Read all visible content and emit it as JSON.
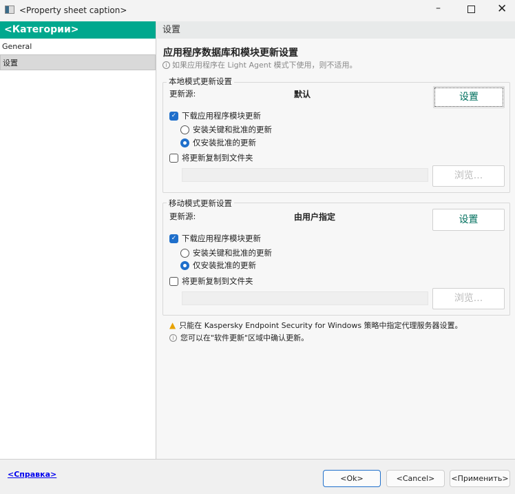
{
  "window": {
    "title": "<Property sheet caption>"
  },
  "sidebar": {
    "header": "<Категории>",
    "items": [
      {
        "label": "General"
      },
      {
        "label": "设置"
      }
    ]
  },
  "main": {
    "header": "设置",
    "title": "应用程序数据库和模块更新设置",
    "subtitle": "如果应用程序在 Light Agent 模式下使用，则不适用。",
    "local": {
      "legend": "本地模式更新设置",
      "source_label": "更新源:",
      "source_value": "默认",
      "settings_button": "设置",
      "download_modules": "下载应用程序模块更新",
      "download_checked": true,
      "radio1": "安装关键和批准的更新",
      "radio2": "仅安装批准的更新",
      "selected_radio": 2,
      "copy_label": "将更新复制到文件夹",
      "copy_checked": false,
      "folder_value": "",
      "browse_button": "浏览..."
    },
    "mobile": {
      "legend": "移动模式更新设置",
      "source_label": "更新源:",
      "source_value": "由用户指定",
      "settings_button": "设置",
      "download_modules": "下载应用程序模块更新",
      "download_checked": true,
      "radio1": "安装关键和批准的更新",
      "radio2": "仅安装批准的更新",
      "selected_radio": 2,
      "copy_label": "将更新复制到文件夹",
      "copy_checked": false,
      "folder_value": "",
      "browse_button": "浏览..."
    },
    "notes": {
      "warning": "只能在 Kaspersky Endpoint Security for Windows 策略中指定代理服务器设置。",
      "info": "您可以在\"软件更新\"区域中确认更新。"
    }
  },
  "footer": {
    "help": "<Справка>",
    "ok": "<Ok>",
    "cancel": "<Cancel>",
    "apply": "<Применить>"
  },
  "colors": {
    "accent": "#00a88e",
    "checkbox": "#1f6fcb",
    "link": "#0000ee"
  }
}
